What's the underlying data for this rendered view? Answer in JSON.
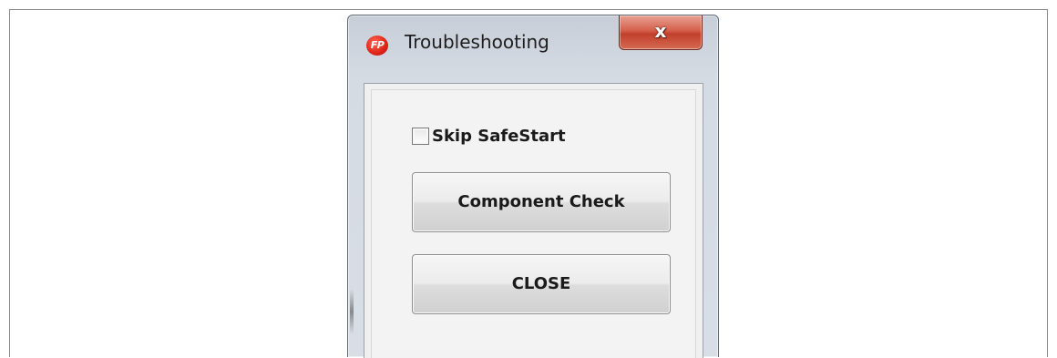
{
  "window": {
    "title": "Troubleshooting",
    "app_icon_text": "FP",
    "close_glyph": "x"
  },
  "form": {
    "skip_safestart": {
      "label": "Skip SafeStart",
      "checked": false
    },
    "component_check_label": "Component Check",
    "close_label": "CLOSE"
  },
  "colors": {
    "close_button": "#d4604b",
    "app_icon": "#e0281a",
    "window_frame": "#d5dbe3",
    "client_area": "#f0f0f0"
  },
  "icons": {
    "app": "app-logo-icon",
    "close": "close-icon",
    "checkbox": "checkbox-icon"
  }
}
